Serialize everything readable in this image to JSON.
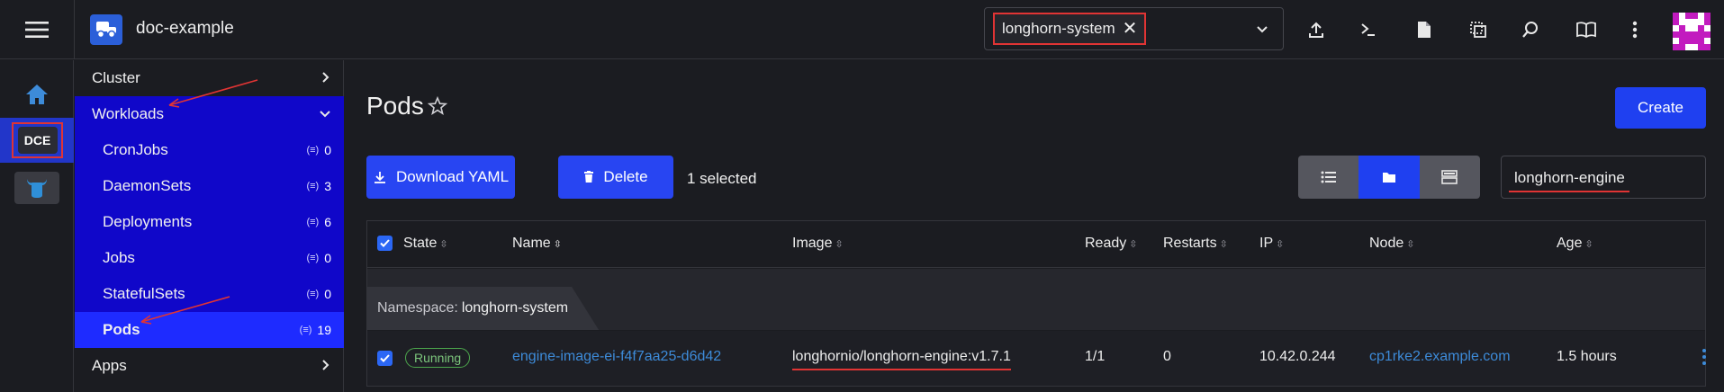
{
  "header": {
    "cluster_name": "doc-example",
    "namespace_chip": "longhorn-system",
    "icons": [
      "upload-icon",
      "terminal-icon",
      "file-icon",
      "copy-icon",
      "search-icon",
      "book-icon",
      "more-vertical-icon"
    ]
  },
  "rail": {
    "items": [
      {
        "name": "home-icon"
      },
      {
        "name": "cluster-dce",
        "label": "DCE"
      },
      {
        "name": "cow-icon"
      }
    ]
  },
  "sidenav": {
    "cluster": "Cluster",
    "workloads": "Workloads",
    "items": [
      {
        "label": "CronJobs",
        "count": "0"
      },
      {
        "label": "DaemonSets",
        "count": "3"
      },
      {
        "label": "Deployments",
        "count": "6"
      },
      {
        "label": "Jobs",
        "count": "0"
      },
      {
        "label": "StatefulSets",
        "count": "0"
      },
      {
        "label": "Pods",
        "count": "19"
      }
    ],
    "apps": "Apps"
  },
  "main": {
    "title": "Pods",
    "create_label": "Create",
    "download_label": "Download YAML",
    "delete_label": "Delete",
    "selected_text": "1 selected",
    "filter_value": "longhorn-engine"
  },
  "table": {
    "columns": [
      "State",
      "Name",
      "Image",
      "Ready",
      "Restarts",
      "IP",
      "Node",
      "Age"
    ],
    "namespace_label": "Namespace:",
    "namespace_value": "longhorn-system",
    "rows": [
      {
        "state": "Running",
        "name": "engine-image-ei-f4f7aa25-d6d42",
        "image": "longhornio/longhorn-engine:v1.7.1",
        "ready": "1/1",
        "restarts": "0",
        "ip": "10.42.0.244",
        "node": "cp1rke2.example.com",
        "age": "1.5 hours"
      }
    ]
  },
  "colors": {
    "accent": "#1f40f0",
    "nav_highlight": "#1007c9",
    "annotation": "#e03434",
    "running": "#4da84d",
    "link": "#3d8bd9"
  }
}
